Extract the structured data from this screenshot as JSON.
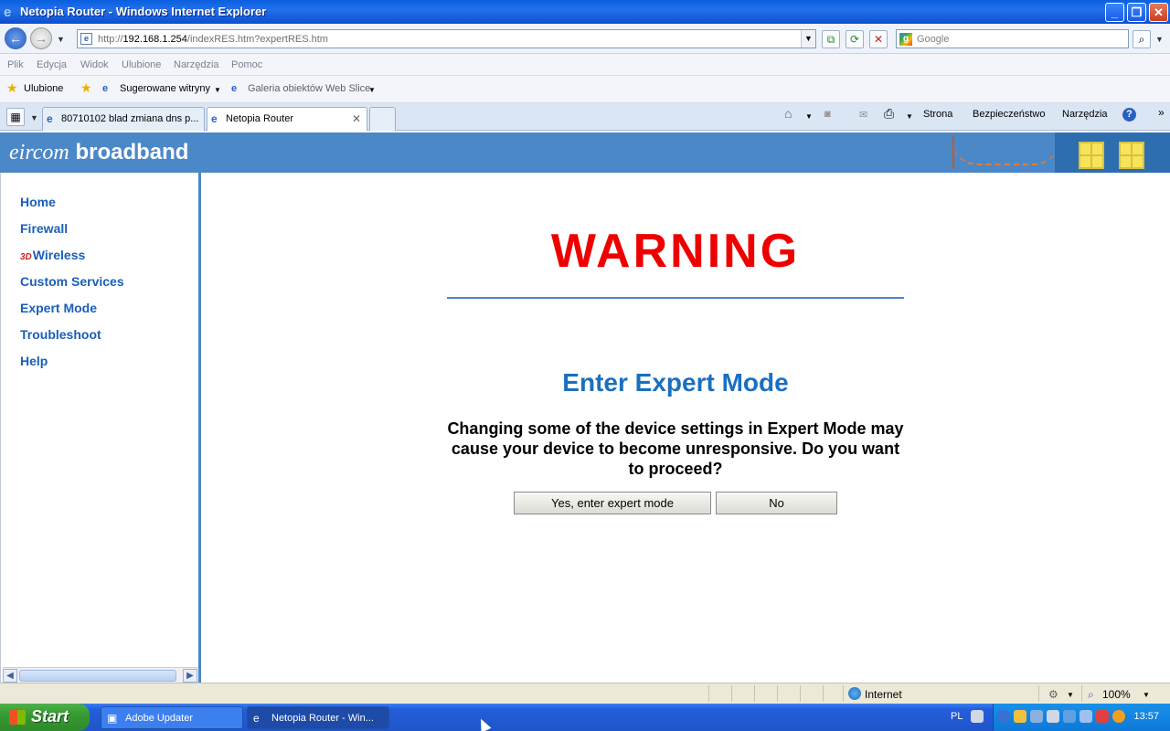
{
  "window": {
    "title": "Netopia Router - Windows Internet Explorer"
  },
  "address": {
    "url_prefix": "http://",
    "url_host": "192.168.1.254",
    "url_path": "/indexRES.htm?expertRES.htm"
  },
  "search": {
    "placeholder": "Google"
  },
  "menu": [
    "Plik",
    "Edycja",
    "Widok",
    "Ulubione",
    "Narzędzia",
    "Pomoc"
  ],
  "favorites": {
    "favorites_label": "Ulubione",
    "suggested_label": "Sugerowane witryny",
    "gallery_label": "Galeria obiektów Web Slice"
  },
  "tabs": [
    {
      "label": "80710102 blad zmiana dns p..."
    },
    {
      "label": "Netopia Router"
    }
  ],
  "commandbar": {
    "page": "Strona",
    "security": "Bezpieczeństwo",
    "tools": "Narzędzia"
  },
  "site": {
    "brand_italic": "eircom",
    "brand_bold": "broadband",
    "nav": [
      "Home",
      "Firewall",
      "Wireless",
      "Custom Services",
      "Expert Mode",
      "Troubleshoot",
      "Help"
    ],
    "wireless_badge": "3D",
    "warning": "WARNING",
    "heading": "Enter Expert Mode",
    "message": "Changing some of the device settings in Expert Mode may cause your device to become unresponsive. Do you want to proceed?",
    "yes_button": "Yes, enter expert mode",
    "no_button": "No"
  },
  "status": {
    "zone": "Internet",
    "zoom": "100%"
  },
  "taskbar": {
    "start": "Start",
    "items": [
      "Adobe Updater",
      "Netopia Router - Win..."
    ],
    "language": "PL",
    "clock": "13:57"
  },
  "colors": {
    "warning": "#ee0000",
    "heading": "#1a6fc0",
    "link": "#1a5fb8",
    "banner": "#4b88c8"
  }
}
